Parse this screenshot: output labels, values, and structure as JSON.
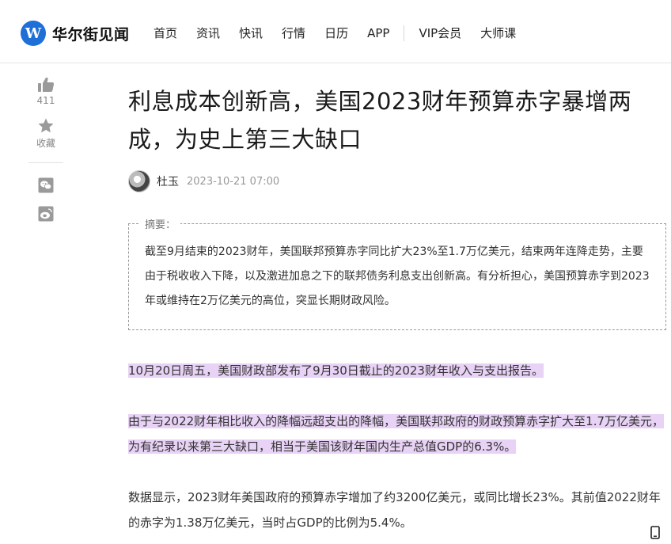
{
  "header": {
    "logo_text": "华尔街见闻",
    "nav": [
      "首页",
      "资讯",
      "快讯",
      "行情",
      "日历",
      "APP"
    ],
    "nav_extra": [
      "VIP会员",
      "大师课"
    ]
  },
  "rail": {
    "like_count": "411",
    "favorite_label": "收藏"
  },
  "article": {
    "title": "利息成本创新高，美国2023财年预算赤字暴增两成，为史上第三大缺口",
    "author": "杜玉",
    "date": "2023-10-21 07:00",
    "summary_label": "摘要：",
    "summary": "截至9月结束的2023财年，美国联邦预算赤字同比扩大23%至1.7万亿美元，结束两年连降走势，主要由于税收收入下降，以及激进加息之下的联邦债务利息支出创新高。有分析担心，美国预算赤字到2023年或维持在2万亿美元的高位，突显长期财政风险。",
    "paragraphs": [
      "10月20日周五，美国财政部发布了9月30日截止的2023财年收入与支出报告。",
      "由于与2022财年相比收入的降幅远超支出的降幅，美国联邦政府的财政预算赤字扩大至1.7万亿美元，为有纪录以来第三大缺口，相当于美国该财年国内生产总值GDP的6.3%。",
      "数据显示，2023财年美国政府的预算赤字增加了约3200亿美元，或同比增长23%。其前值2022财年的赤字为1.38万亿美元，当时占GDP的比例为5.4%。"
    ]
  },
  "colors": {
    "brand": "#1e6fd8",
    "highlight": "#e8d2f5"
  },
  "icons": [
    "logo-w-icon",
    "thumb-up-icon",
    "star-icon",
    "wechat-icon",
    "weibo-icon",
    "mobile-icon"
  ]
}
